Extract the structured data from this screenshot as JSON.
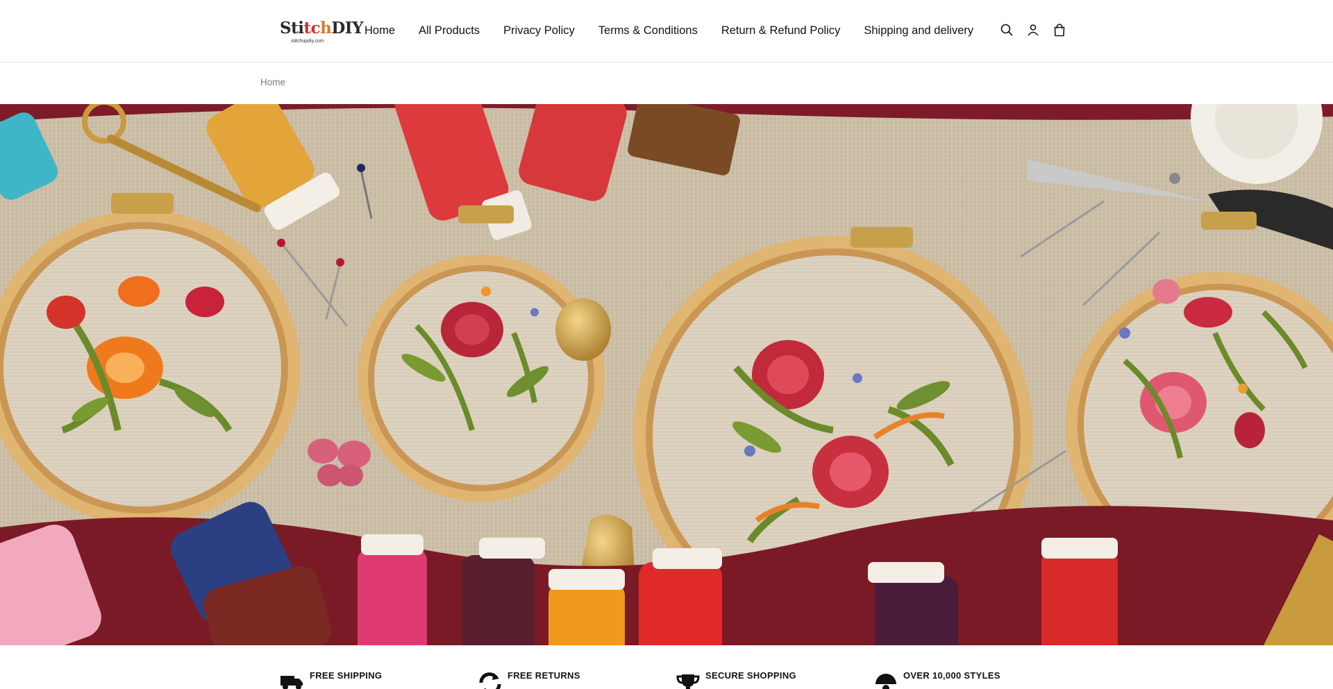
{
  "brand": {
    "name_parts": [
      "Sti",
      "tc",
      "h",
      "DIY"
    ],
    "domain": "stitchupdiy.com"
  },
  "nav": {
    "items": [
      {
        "label": "Home"
      },
      {
        "label": "All Products"
      },
      {
        "label": "Privacy Policy"
      },
      {
        "label": "Terms & Conditions"
      },
      {
        "label": "Return & Refund Policy"
      },
      {
        "label": "Shipping and delivery"
      }
    ]
  },
  "header_icons": [
    "search-icon",
    "account-icon",
    "cart-icon"
  ],
  "breadcrumb": {
    "items": [
      {
        "label": "Home"
      }
    ]
  },
  "hero": {
    "subject": "embroidery hoops with floral designs"
  },
  "features": [
    {
      "title": "FREE SHIPPING",
      "icon": "truck-icon"
    },
    {
      "title": "FREE RETURNS",
      "icon": "returns-icon"
    },
    {
      "title": "SECURE SHOPPING",
      "icon": "trophy-icon"
    },
    {
      "title": "OVER 10,000 STYLES",
      "icon": "styles-icon"
    }
  ],
  "colors": {
    "text": "#121212",
    "muted": "#7a7a7a",
    "border": "#e4e4e4",
    "linen": "#cfc2ab",
    "hoop": "#d9a866",
    "burgundy": "#7a1a26"
  }
}
